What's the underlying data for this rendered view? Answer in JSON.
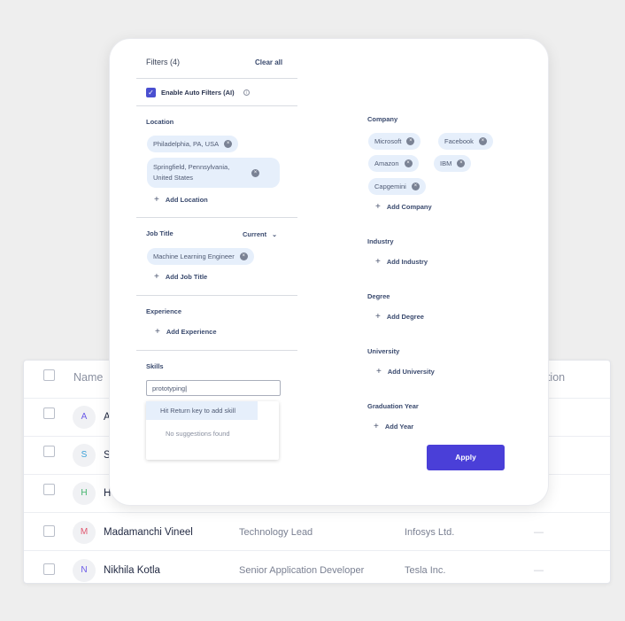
{
  "table": {
    "header": {
      "name": "Name",
      "location_partial": "ation"
    },
    "rows": [
      {
        "initial": "A",
        "initial_color": "#6b5be8",
        "name": "A",
        "title": "",
        "company": "",
        "location": ""
      },
      {
        "initial": "S",
        "initial_color": "#3aa0d8",
        "name": "S",
        "title": "",
        "company": "",
        "location": ""
      },
      {
        "initial": "H",
        "initial_color": "#3fb36a",
        "name": "H",
        "title": "",
        "company": "",
        "location": ""
      },
      {
        "initial": "M",
        "initial_color": "#e0566e",
        "name": "Madamanchi Vineel",
        "title": "Technology Lead",
        "company": "Infosys Ltd.",
        "location": "—"
      },
      {
        "initial": "N",
        "initial_color": "#6b5be8",
        "name": "Nikhila Kotla",
        "title": "Senior Application Developer",
        "company": "Tesla Inc.",
        "location": "—"
      }
    ]
  },
  "filters": {
    "title": "Filters (4)",
    "clear_all": "Clear all",
    "auto_filters_label": "Enable Auto Filters (AI)",
    "info_icon": "i",
    "check_glyph": "✓",
    "remove_glyph": "×",
    "plus_glyph": "+",
    "location": {
      "title": "Location",
      "chips": [
        "Philadelphia, PA, USA",
        "Springfield, Pennsylvania, United States"
      ],
      "add_label": "Add Location"
    },
    "job_title": {
      "title": "Job Title",
      "mode": "Current",
      "chevron": "⌄",
      "chips": [
        "Machine Learning Engineer"
      ],
      "add_label": "Add Job Title"
    },
    "experience": {
      "title": "Experience",
      "add_label": "Add Experience"
    },
    "skills": {
      "title": "Skills",
      "input_value": "prototyping",
      "hint": "Hit Return key to add skill",
      "empty": "No suggestions found"
    },
    "company": {
      "title": "Company",
      "chips": [
        "Microsoft",
        "Facebook",
        "Amazon",
        "IBM",
        "Capgemini"
      ],
      "add_label": "Add Company"
    },
    "industry": {
      "title": "Industry",
      "add_label": "Add Industry"
    },
    "degree": {
      "title": "Degree",
      "add_label": "Add Degree"
    },
    "university": {
      "title": "University",
      "add_label": "Add University"
    },
    "graduation_year": {
      "title": "Graduation Year",
      "add_label": "Add Year"
    },
    "apply_label": "Apply"
  },
  "colors": {
    "accent": "#4a3fd8",
    "chip_bg": "#e6effb",
    "checkbox": "#4a4fd0"
  }
}
